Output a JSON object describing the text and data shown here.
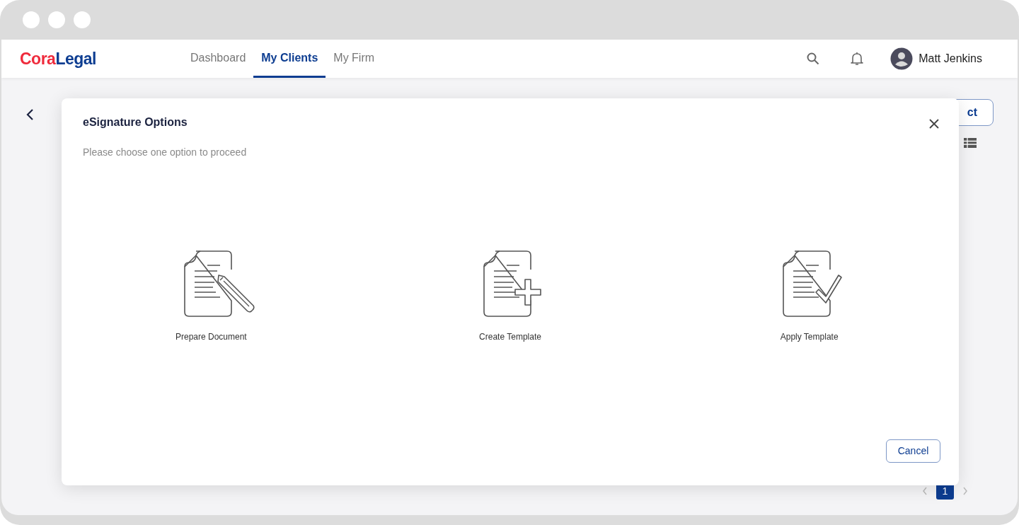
{
  "logo": {
    "first": "Cora",
    "second": "Legal"
  },
  "nav": [
    {
      "label": "Dashboard",
      "selected": false
    },
    {
      "label": "My Clients",
      "selected": true
    },
    {
      "label": "My Firm",
      "selected": false
    }
  ],
  "user": {
    "name": "Matt Jenkins"
  },
  "background": {
    "partial_button": "ct",
    "pagination": [
      {
        "label": "1",
        "selected": true
      }
    ]
  },
  "modal": {
    "title": "eSignature Options",
    "subtitle": "Please choose one option to proceed",
    "options": [
      {
        "kind": "pencil",
        "label": "Prepare Document"
      },
      {
        "kind": "plus",
        "label": "Create Template"
      },
      {
        "kind": "check",
        "label": "Apply Template"
      }
    ],
    "cancel": "Cancel"
  }
}
